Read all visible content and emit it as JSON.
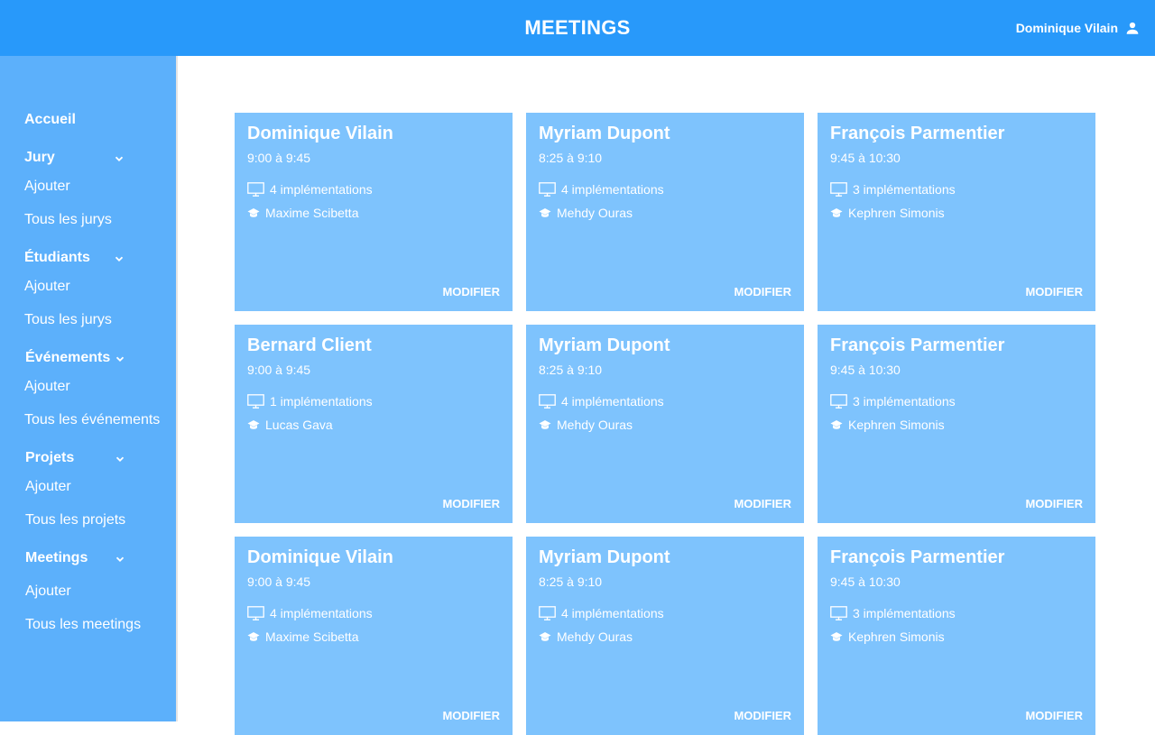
{
  "header": {
    "title": "MEETINGS",
    "user_name": "Dominique Vilain",
    "user_icon": "person-icon",
    "color": "#2899fa"
  },
  "sidebar": {
    "color": "#5cb0fb",
    "items": [
      {
        "label": "Accueil",
        "type": "head"
      },
      {
        "label": "Jury",
        "type": "head",
        "chevron": true
      },
      {
        "label": "Ajouter",
        "type": "sub"
      },
      {
        "label": "Tous les jurys",
        "type": "sub"
      },
      {
        "label": "Étudiants",
        "type": "head",
        "chevron": true
      },
      {
        "label": "Ajouter",
        "type": "sub"
      },
      {
        "label": "Tous les jurys",
        "type": "sub"
      },
      {
        "label": "Événements",
        "type": "head",
        "chevron": true
      },
      {
        "label": "Ajouter",
        "type": "sub"
      },
      {
        "label": "Tous les événements",
        "type": "sub"
      },
      {
        "label": "Projets",
        "type": "head",
        "chevron": true
      },
      {
        "label": "Ajouter",
        "type": "sub"
      },
      {
        "label": "Tous les projets",
        "type": "sub"
      },
      {
        "label": "Meetings",
        "type": "head",
        "chevron": true
      },
      {
        "label": "Ajouter",
        "type": "sub"
      },
      {
        "label": "Tous les meetings",
        "type": "sub"
      }
    ]
  },
  "cards": [
    {
      "name": "Dominique Vilain",
      "time": "9:00 à 9:45",
      "implementations": "4 implémentations",
      "student": "Maxime Scibetta",
      "action": "MODIFIER"
    },
    {
      "name": "Myriam Dupont",
      "time": "8:25 à 9:10",
      "implementations": "4 implémentations",
      "student": "Mehdy Ouras",
      "action": "MODIFIER"
    },
    {
      "name": "François Parmentier",
      "time": "9:45 à 10:30",
      "implementations": "3 implémentations",
      "student": "Kephren Simonis",
      "action": "MODIFIER"
    },
    {
      "name": "Bernard Client",
      "time": "9:00 à 9:45",
      "implementations": "1 implémentations",
      "student": "Lucas Gava",
      "action": "MODIFIER"
    },
    {
      "name": "Myriam Dupont",
      "time": "8:25 à 9:10",
      "implementations": "4 implémentations",
      "student": "Mehdy Ouras",
      "action": "MODIFIER"
    },
    {
      "name": "François Parmentier",
      "time": "9:45 à 10:30",
      "implementations": "3 implémentations",
      "student": "Kephren Simonis",
      "action": "MODIFIER"
    },
    {
      "name": "Dominique Vilain",
      "time": "9:00 à 9:45",
      "implementations": "4 implémentations",
      "student": "Maxime Scibetta",
      "action": "MODIFIER"
    },
    {
      "name": "Myriam Dupont",
      "time": "8:25 à 9:10",
      "implementations": "4 implémentations",
      "student": "Mehdy Ouras",
      "action": "MODIFIER"
    },
    {
      "name": "François Parmentier",
      "time": "9:45 à 10:30",
      "implementations": "3 implémentations",
      "student": "Kephren Simonis",
      "action": "MODIFIER"
    }
  ],
  "card_color": "#7ec3fd",
  "icons": {
    "implementations": "monitor-icon",
    "student": "graduation-cap-icon",
    "section_toggle": "chevron-down-icon"
  }
}
